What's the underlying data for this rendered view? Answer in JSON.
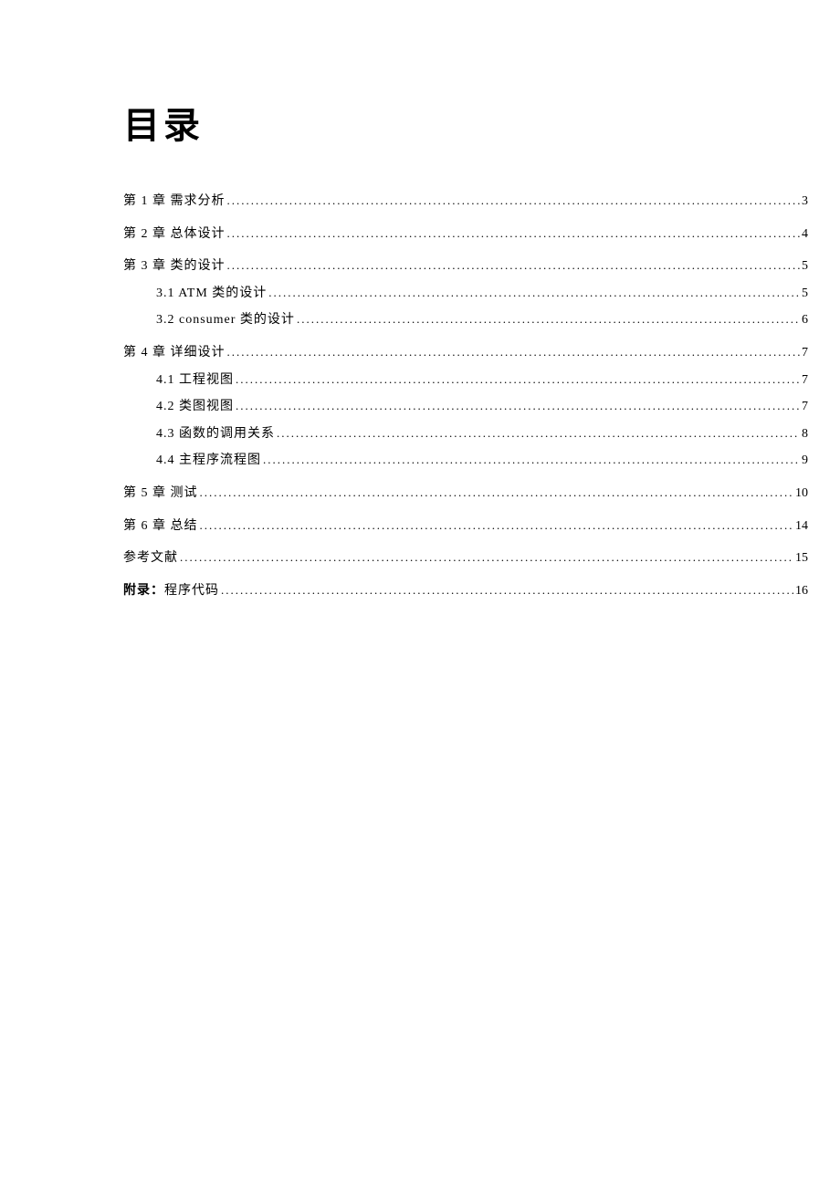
{
  "title": "目录",
  "entries": [
    {
      "label": "第 1 章 需求分析",
      "page": "3",
      "level": 1
    },
    {
      "label": "第 2 章 总体设计",
      "page": "4",
      "level": 1
    },
    {
      "label": "第 3 章 类的设计",
      "page": "5",
      "level": 1
    },
    {
      "label": "3.1 ATM 类的设计",
      "page": "5",
      "level": 2
    },
    {
      "label": "3.2 consumer 类的设计",
      "page": "6",
      "level": 2
    },
    {
      "label": "第 4 章 详细设计",
      "page": "7",
      "level": 1
    },
    {
      "label": "4.1 工程视图",
      "page": "7",
      "level": 2
    },
    {
      "label": "4.2 类图视图",
      "page": "7",
      "level": 2
    },
    {
      "label": "4.3 函数的调用关系",
      "page": "8",
      "level": 2
    },
    {
      "label": "4.4 主程序流程图",
      "page": "9",
      "level": 2
    },
    {
      "label": "第 5 章 测试",
      "page": "10",
      "level": 1
    },
    {
      "label": "第 6 章 总结",
      "page": "14",
      "level": 1
    },
    {
      "label": "参考文献",
      "page": "15",
      "level": 1
    },
    {
      "label_bold": "附录：",
      "label_rest": "程序代码",
      "page": "16",
      "level": 1,
      "has_bold": true
    }
  ]
}
